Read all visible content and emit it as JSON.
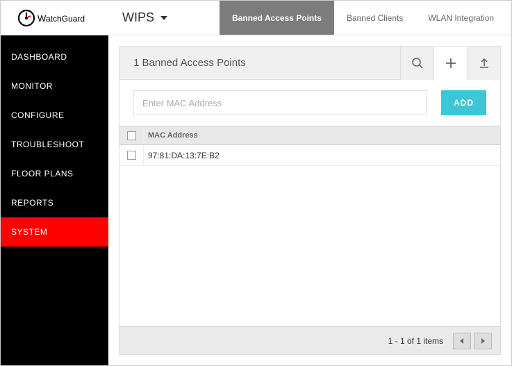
{
  "brand": "WatchGuard",
  "sidebar": {
    "items": [
      {
        "label": "DASHBOARD"
      },
      {
        "label": "MONITOR"
      },
      {
        "label": "CONFIGURE"
      },
      {
        "label": "TROUBLESHOOT"
      },
      {
        "label": "FLOOR PLANS"
      },
      {
        "label": "REPORTS"
      },
      {
        "label": "SYSTEM"
      }
    ],
    "active_index": 6
  },
  "topbar": {
    "section": "WIPS",
    "tabs": [
      {
        "label": "Banned Access Points"
      },
      {
        "label": "Banned Clients"
      },
      {
        "label": "WLAN Integration"
      }
    ],
    "active_tab": 0
  },
  "panel": {
    "title": "1 Banned Access Points",
    "input_placeholder": "Enter MAC Address",
    "add_button": "ADD",
    "column_header": "MAC Address",
    "rows": [
      {
        "mac": "97:81:DA:13:7E:B2"
      }
    ],
    "footer_text": "1 - 1 of 1 items"
  }
}
